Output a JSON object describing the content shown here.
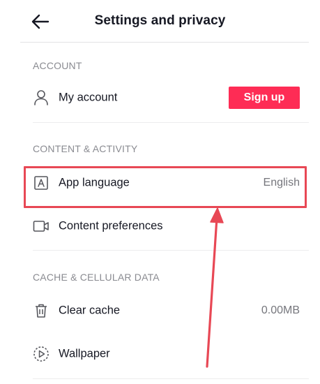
{
  "header": {
    "title": "Settings and privacy",
    "back_icon": "back-arrow-icon"
  },
  "sections": {
    "account": {
      "heading": "ACCOUNT",
      "items": [
        {
          "label": "My account",
          "icon": "person-icon",
          "button_label": "Sign up"
        }
      ]
    },
    "content_activity": {
      "heading": "CONTENT & ACTIVITY",
      "items": [
        {
          "label": "App language",
          "value": "English",
          "icon": "language-icon"
        },
        {
          "label": "Content preferences",
          "icon": "video-camera-icon"
        }
      ]
    },
    "cache": {
      "heading": "CACHE & CELLULAR DATA",
      "items": [
        {
          "label": "Clear cache",
          "value": "0.00MB",
          "icon": "trash-icon"
        },
        {
          "label": "Wallpaper",
          "icon": "wallpaper-play-icon"
        }
      ]
    }
  },
  "annotation": {
    "color": "#e84855",
    "target": "App language"
  },
  "colors": {
    "accent": "#fe2c55",
    "section_heading": "#8a8b91",
    "text": "#161823"
  }
}
